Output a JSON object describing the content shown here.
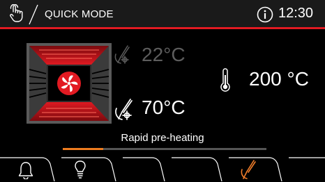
{
  "header": {
    "title": "QUICK MODE",
    "time": "12:30",
    "icons": {
      "left": "touch-hand-icon",
      "right": "info-icon"
    }
  },
  "temperatures": {
    "probe_current": "22°C",
    "probe_target": "70°C",
    "oven_setpoint": "200 °C"
  },
  "status": {
    "text": "Rapid pre-heating",
    "progress": 0.2
  },
  "tabs": [
    {
      "name": "alarm",
      "icon": "bell-icon"
    },
    {
      "name": "light",
      "icon": "light-bulb-icon"
    },
    {
      "name": "empty-1",
      "icon": ""
    },
    {
      "name": "empty-2",
      "icon": ""
    },
    {
      "name": "core-probe",
      "icon": "core-probe-icon"
    },
    {
      "name": "empty-3",
      "icon": ""
    }
  ],
  "colors": {
    "accent_red": "#e21a22",
    "progress_orange": "#ee7c1f",
    "active_probe_orange": "#f07d2a",
    "header_bg": "#1a1a1a",
    "dim_text": "#5d5d5d"
  }
}
